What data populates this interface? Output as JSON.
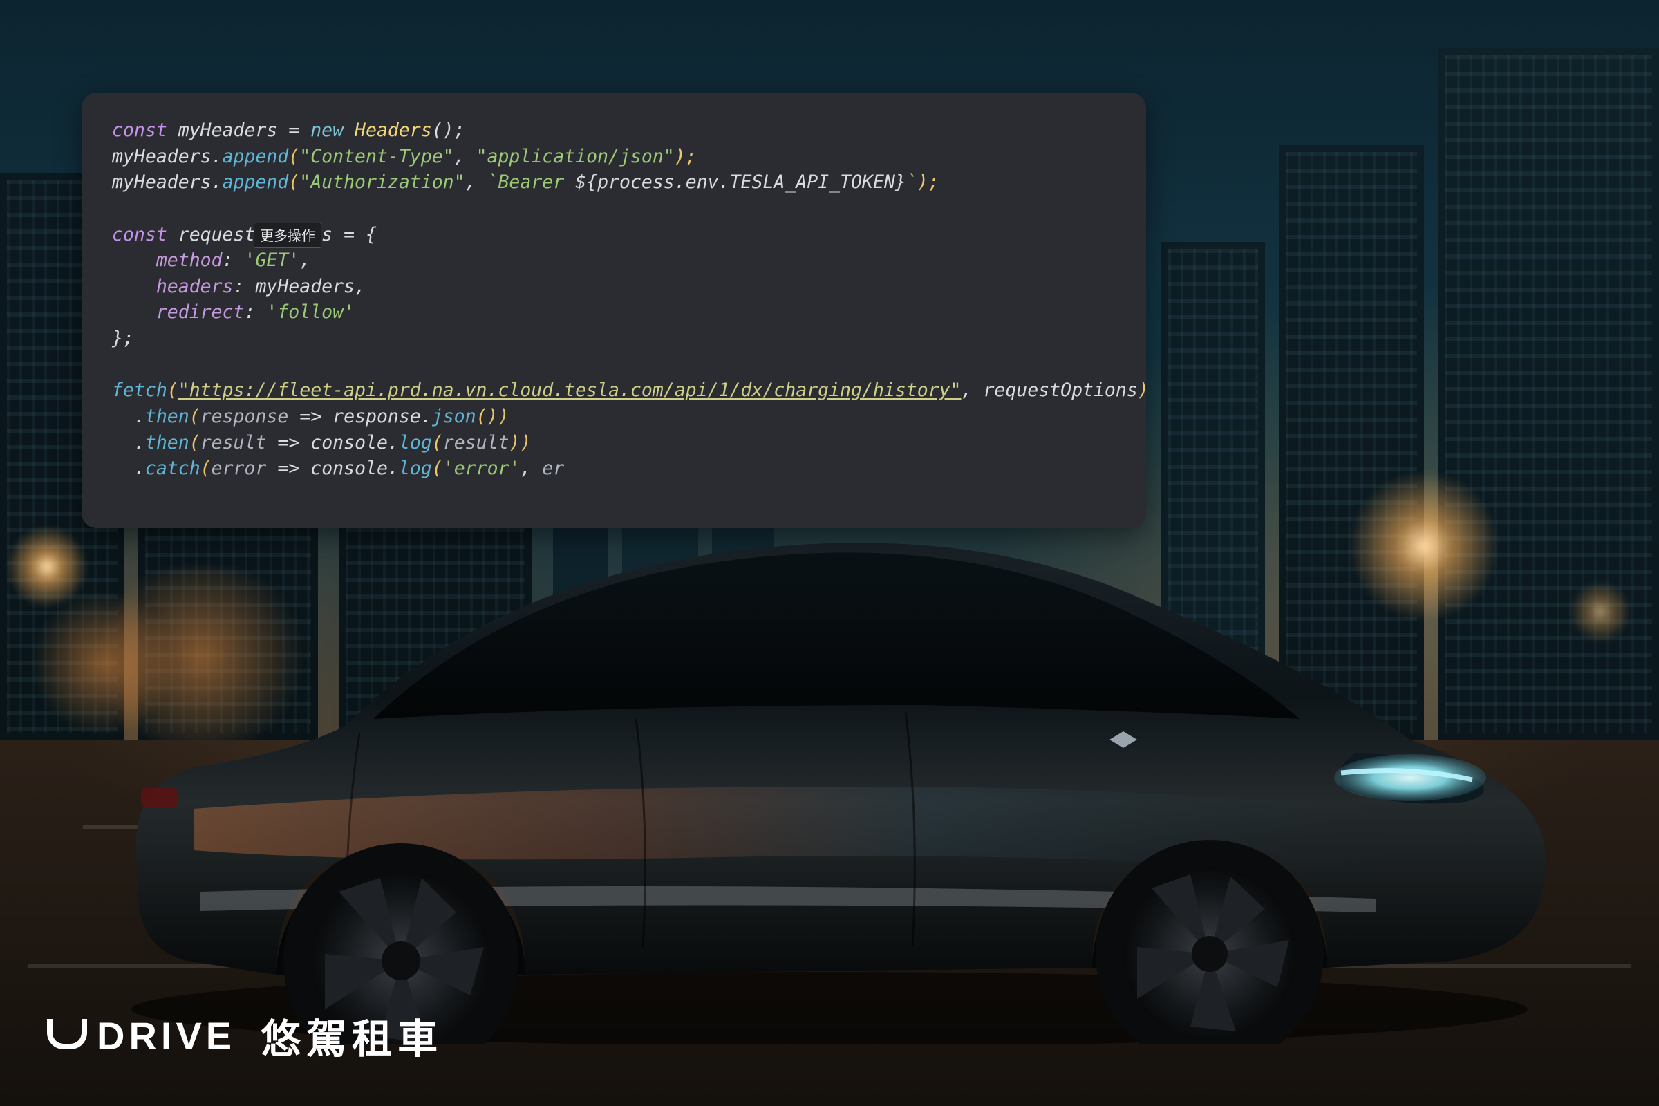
{
  "tooltip": {
    "more_actions": "更多操作"
  },
  "logo": {
    "en": "DRIVE",
    "cn": "悠駕租車"
  },
  "code": {
    "line1": {
      "kw": "const",
      "v": " myHeaders ",
      "op": "=",
      "nw": " new ",
      "cls": "Headers",
      "tail": "();"
    },
    "line2": {
      "obj": "myHeaders",
      "dot": ".",
      "mth": "append",
      "a1": "\"Content-Type\"",
      "sep": ", ",
      "a2": "\"application/json\"",
      "tail": ");"
    },
    "line3": {
      "obj": "myHeaders",
      "dot": ".",
      "mth": "append",
      "a1": "\"Authorization\"",
      "sep": ", ",
      "bt1": "`Bearer ",
      "tplOpen": "${",
      "tpl": "process",
      "tpldot1": ".",
      "tplenv": "env",
      "tpldot2": ".",
      "tpltok": "TESLA_API_TOKEN",
      "tplClose": "}",
      "bt2": "`",
      "tail": ");"
    },
    "line5": {
      "kw": "const",
      "v": " requestOptions ",
      "op": "= {"
    },
    "line6": {
      "indent": "    ",
      "prop": "method",
      "colon": ": ",
      "val": "'GET'",
      "comma": ","
    },
    "line7": {
      "indent": "    ",
      "prop": "headers",
      "colon": ": ",
      "val": "myHeaders",
      "comma": ","
    },
    "line8": {
      "indent": "    ",
      "prop": "redirect",
      "colon": ": ",
      "val": "'follow'"
    },
    "line9": {
      "close": "};"
    },
    "line11": {
      "mth": "fetch",
      "open": "(",
      "url": "\"https://fleet-api.prd.na.vn.cloud.tesla.com/api/1/dx/charging/history\"",
      "sep": ", ",
      "arg": "requestOptions",
      "close": ")"
    },
    "line12": {
      "indent": "  ",
      "dot": ".",
      "mth": "then",
      "open": "(",
      "prm": "response",
      "arrow": " => ",
      "obj": "response",
      "dot2": ".",
      "mth2": "json",
      "tail": "())"
    },
    "line13": {
      "indent": "  ",
      "dot": ".",
      "mth": "then",
      "open": "(",
      "prm": "result",
      "arrow": " => ",
      "obj": "console",
      "dot2": ".",
      "mth2": "log",
      "open2": "(",
      "prm2": "result",
      "tail": "))"
    },
    "line14": {
      "indent": "  ",
      "dot": ".",
      "mth": "catch",
      "open": "(",
      "prm": "error",
      "arrow": " => ",
      "obj": "console",
      "dot2": ".",
      "mth2": "log",
      "open2": "(",
      "str": "'error'",
      "sep": ", ",
      "trail": "er"
    }
  }
}
